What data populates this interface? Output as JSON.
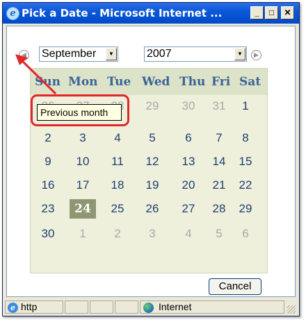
{
  "window": {
    "title": "Pick a Date - Microsoft Internet ...",
    "minimize_label": "_",
    "maximize_label": "□",
    "close_label": "✕"
  },
  "nav": {
    "prev_glyph": "◀",
    "next_glyph": "▶",
    "month_value": "September",
    "year_value": "2007"
  },
  "calendar": {
    "weekday_headers": [
      "Sun",
      "Mon",
      "Tue",
      "Wed",
      "Thu",
      "Fri",
      "Sat"
    ],
    "weeks": [
      [
        "26",
        "27",
        "28",
        "29",
        "30",
        "31",
        "1"
      ],
      [
        "2",
        "3",
        "4",
        "5",
        "6",
        "7",
        "8"
      ],
      [
        "9",
        "10",
        "11",
        "12",
        "13",
        "14",
        "15"
      ],
      [
        "16",
        "17",
        "18",
        "19",
        "20",
        "21",
        "22"
      ],
      [
        "23",
        "24",
        "25",
        "26",
        "27",
        "28",
        "29"
      ],
      [
        "30",
        "1",
        "2",
        "3",
        "4",
        "5",
        "6"
      ]
    ],
    "selected_day": "24"
  },
  "tooltip": {
    "text": "Previous month"
  },
  "buttons": {
    "cancel_label": "Cancel"
  },
  "statusbar": {
    "url_text": "http",
    "zone_text": "Internet"
  },
  "colors": {
    "titlebar": "#0a58d8",
    "calendar_bg": "#eef0dc",
    "header_bg": "#dde3c8",
    "weekday_text": "#3a6496",
    "selected_bg": "#8f9673",
    "highlight": "#e0282b",
    "tooltip_bg": "#ffffe1"
  }
}
